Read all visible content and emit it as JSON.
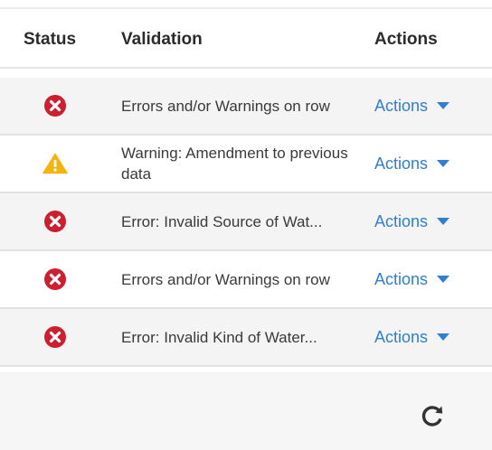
{
  "table": {
    "headers": {
      "status": "Status",
      "validation": "Validation",
      "actions": "Actions"
    },
    "rows": [
      {
        "status_icon": "error-icon",
        "validation": "Errors and/or Warnings on row",
        "actions_label": "Actions"
      },
      {
        "status_icon": "warning-icon",
        "validation": "Warning: Amendment to previous data",
        "actions_label": "Actions"
      },
      {
        "status_icon": "error-icon",
        "validation": "Error: Invalid Source of Wat...",
        "actions_label": "Actions"
      },
      {
        "status_icon": "error-icon",
        "validation": "Errors and/or Warnings on row",
        "actions_label": "Actions"
      },
      {
        "status_icon": "error-icon",
        "validation": "Error: Invalid Kind of Water...",
        "actions_label": "Actions"
      }
    ]
  },
  "footer": {
    "refresh_icon": "refresh-icon"
  },
  "colors": {
    "error": "#cc1f2f",
    "warning": "#f2b40f",
    "link": "#2f7fd0"
  }
}
